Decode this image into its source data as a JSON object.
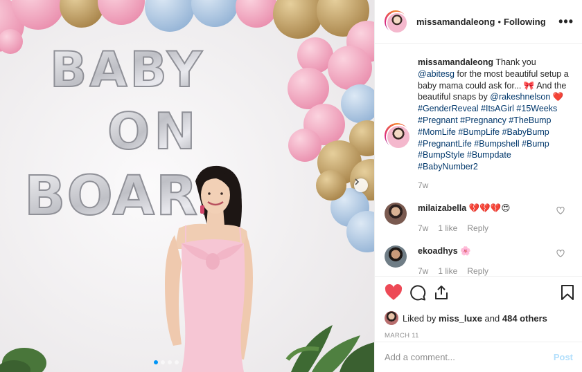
{
  "photo": {
    "balloon_letters": [
      "BABY",
      "ON",
      "BOARD"
    ],
    "colors": {
      "pink": "#f2a9c0",
      "gold": "#c9a66b",
      "blue": "#b7cfe8",
      "silver": "#d8d8dc",
      "dress": "#f6c6d4",
      "wall": "#f4f2f3"
    },
    "carousel": {
      "count": 4,
      "active": 1
    }
  },
  "header": {
    "username": "missamandaleong",
    "separator": "•",
    "follow_status": "Following",
    "more_icon": "more-dots-icon",
    "more_label": "•••"
  },
  "caption": {
    "username": "missamandaleong",
    "line1": " Thank you ",
    "mention1": "@abitesg",
    "line2": " for the most beautiful setup a baby mama could ask for... ",
    "bow_emoji": "🎀",
    "line3": " And the beautiful snaps by ",
    "mention2": "@rakeshnelson",
    "heart_emoji": "❤️",
    "hashtags": "#GenderReveal #ItsAGirl #15Weeks #Pregnant #Pregnancy #TheBump #MomLife #BumpLife #BabyBump #PregnantLife #Bumpshell #Bump #BumpStyle #Bumpdate #BabyNumber2",
    "time": "7w"
  },
  "comments": [
    {
      "username": "milaizabella",
      "text": "💔💔💔😍",
      "time": "7w",
      "likes": "1 like",
      "reply": "Reply"
    },
    {
      "username": "ekoadhys",
      "text": "🌸",
      "time": "7w",
      "likes": "1 like",
      "reply": "Reply"
    }
  ],
  "actions": {
    "liked_by_prefix": "Liked by ",
    "liked_by_user": "miss_luxe",
    "liked_by_suffix": " and ",
    "others": "484 others",
    "date": "MARCH 11",
    "like_color": "#ed4956"
  },
  "add_comment": {
    "placeholder": "Add a comment...",
    "post_label": "Post"
  }
}
